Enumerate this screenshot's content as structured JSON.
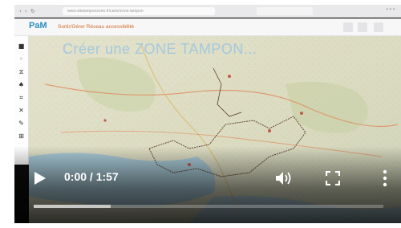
{
  "video": {
    "title_overlay": "Créer une ZONE TAMPON...",
    "current_time": "0:00",
    "duration": "1:57",
    "time_display": "0:00 / 1:57",
    "progress_fraction": 0.0,
    "buffered_fraction": 0.22
  },
  "app": {
    "logo_text": "PaM",
    "header_title": "Sortir/Gérer Réseau accessibilité"
  },
  "browser": {
    "url": "www.sitetamponzone.fr/carte/zone-tampon"
  },
  "controls": {
    "play_icon": "play-icon",
    "volume_icon": "volume-icon",
    "fullscreen_icon": "fullscreen-icon",
    "more_icon": "more-options-icon"
  },
  "colors": {
    "title_overlay": "#9fc7e0",
    "progress_buffered": "#ffffff",
    "played_bar": "#ff0000"
  }
}
